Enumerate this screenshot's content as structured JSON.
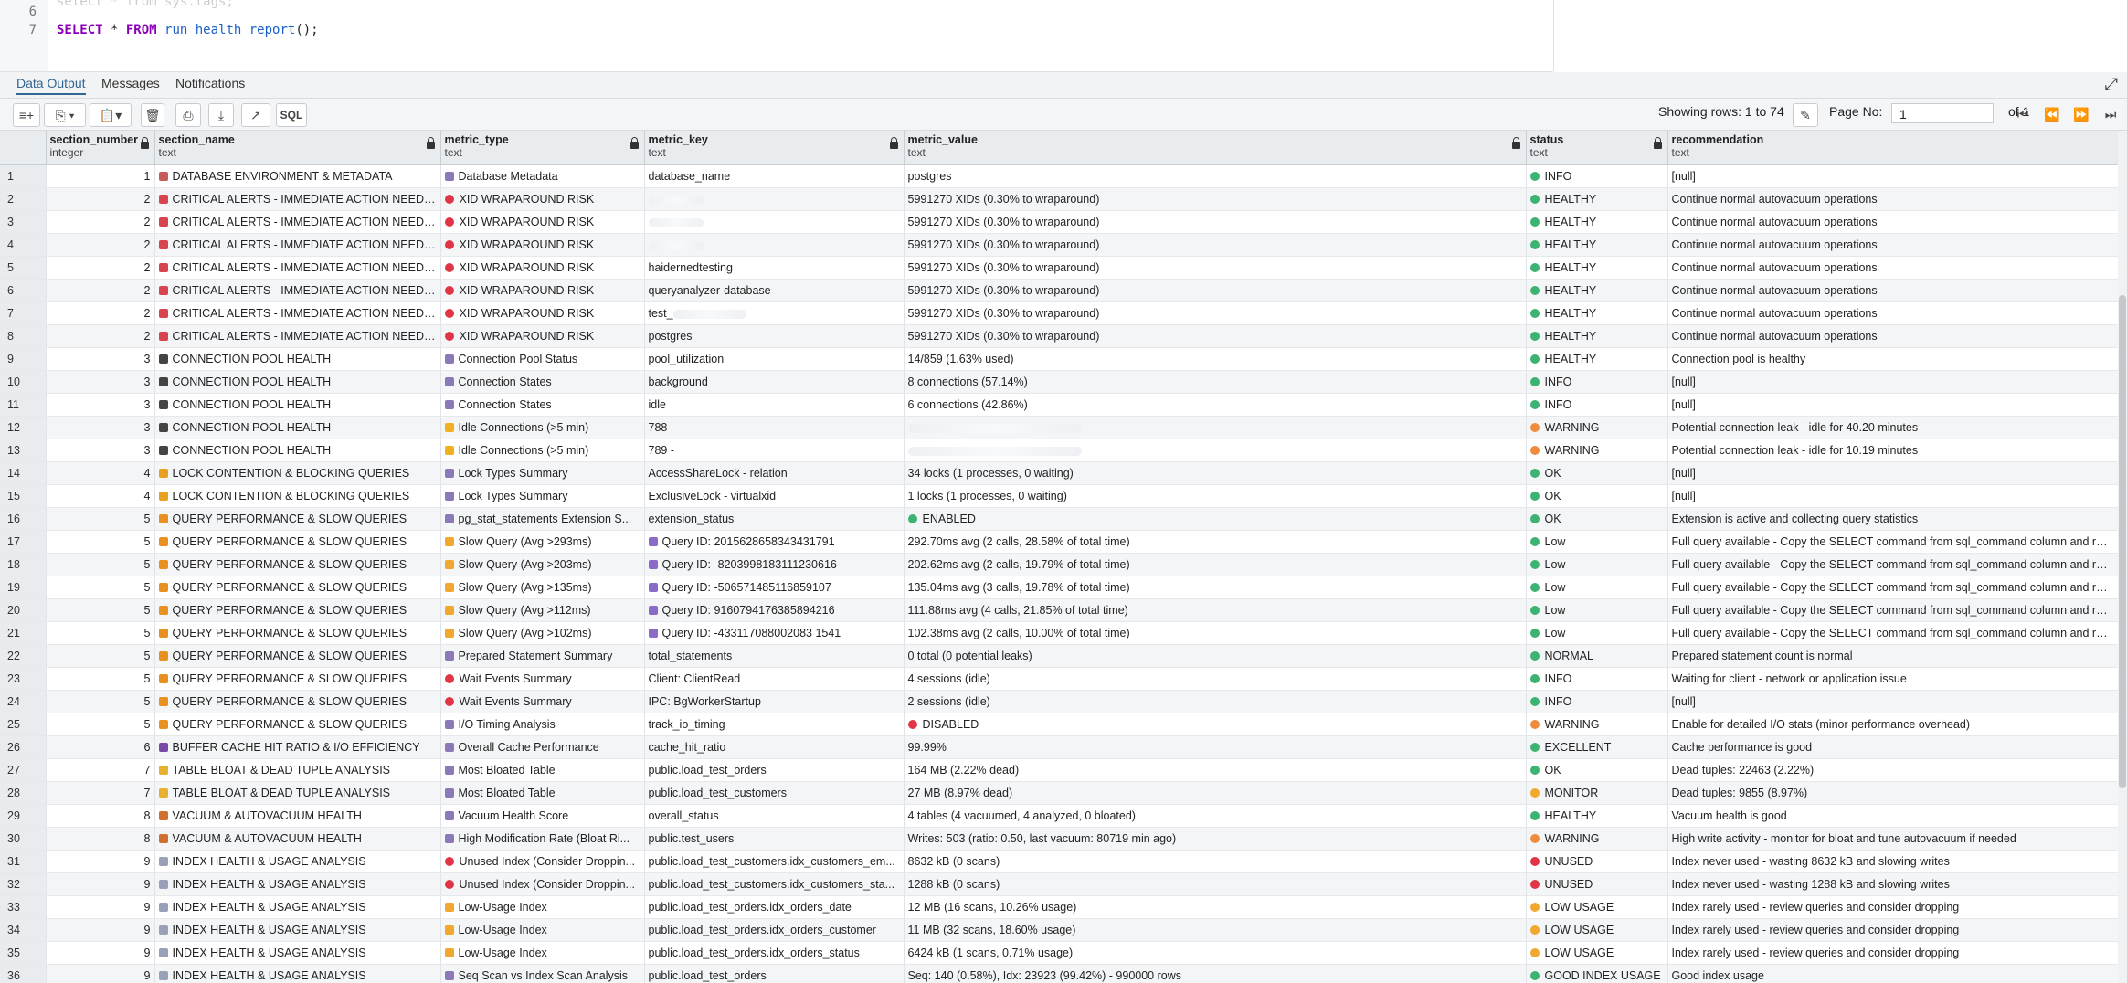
{
  "editor": {
    "line6_number": "6",
    "line7_number": "7",
    "line6_ghost": "select * from sys.tags;",
    "line7_kw1": "SELECT",
    "line7_star": " * ",
    "line7_kw2": "FROM",
    "line7_fn": " run_health_report",
    "line7_end": "();"
  },
  "tabs": [
    "Data Output",
    "Messages",
    "Notifications"
  ],
  "toolbar": {
    "showing_rows": "Showing rows: 1 to 74",
    "page_no_label": "Page No:",
    "page_no_value": "1",
    "of_pages": "of 1",
    "sql_label": "SQL"
  },
  "columns": [
    {
      "name": "section_number",
      "type": "integer"
    },
    {
      "name": "section_name",
      "type": "text"
    },
    {
      "name": "metric_type",
      "type": "text"
    },
    {
      "name": "metric_key",
      "type": "text"
    },
    {
      "name": "metric_value",
      "type": "text"
    },
    {
      "name": "status",
      "type": "text"
    },
    {
      "name": "recommendation",
      "type": "text"
    }
  ],
  "status_colors": {
    "green": "#3cb371",
    "orange": "#f08a3c",
    "red": "#e03546",
    "amber": "#f0a830"
  },
  "rows": [
    [
      "1",
      "1",
      "DATABASE ENVIRONMENT & METADATA",
      "Database Metadata",
      "database_name",
      "postgres",
      "INFO",
      "[null]"
    ],
    [
      "2",
      "2",
      "CRITICAL ALERTS - IMMEDIATE ACTION NEEDED",
      "XID WRAPAROUND RISK",
      "",
      "5991270 XIDs (0.30% to wraparound)",
      "HEALTHY",
      "Continue normal autovacuum operations"
    ],
    [
      "3",
      "2",
      "CRITICAL ALERTS - IMMEDIATE ACTION NEEDED",
      "XID WRAPAROUND RISK",
      "",
      "5991270 XIDs (0.30% to wraparound)",
      "HEALTHY",
      "Continue normal autovacuum operations"
    ],
    [
      "4",
      "2",
      "CRITICAL ALERTS - IMMEDIATE ACTION NEEDED",
      "XID WRAPAROUND RISK",
      "",
      "5991270 XIDs (0.30% to wraparound)",
      "HEALTHY",
      "Continue normal autovacuum operations"
    ],
    [
      "5",
      "2",
      "CRITICAL ALERTS - IMMEDIATE ACTION NEEDED",
      "XID WRAPAROUND RISK",
      "haidernedtesting",
      "5991270 XIDs (0.30% to wraparound)",
      "HEALTHY",
      "Continue normal autovacuum operations"
    ],
    [
      "6",
      "2",
      "CRITICAL ALERTS - IMMEDIATE ACTION NEEDED",
      "XID WRAPAROUND RISK",
      "queryanalyzer-database",
      "5991270 XIDs (0.30% to wraparound)",
      "HEALTHY",
      "Continue normal autovacuum operations"
    ],
    [
      "7",
      "2",
      "CRITICAL ALERTS - IMMEDIATE ACTION NEEDED",
      "XID WRAPAROUND RISK",
      "test_",
      "5991270 XIDs (0.30% to wraparound)",
      "HEALTHY",
      "Continue normal autovacuum operations"
    ],
    [
      "8",
      "2",
      "CRITICAL ALERTS - IMMEDIATE ACTION NEEDED",
      "XID WRAPAROUND RISK",
      "postgres",
      "5991270 XIDs (0.30% to wraparound)",
      "HEALTHY",
      "Continue normal autovacuum operations"
    ],
    [
      "9",
      "3",
      "CONNECTION POOL HEALTH",
      "Connection Pool Status",
      "pool_utilization",
      "14/859 (1.63% used)",
      "HEALTHY",
      "Connection pool is healthy"
    ],
    [
      "10",
      "3",
      "CONNECTION POOL HEALTH",
      "Connection States",
      "background",
      "8 connections (57.14%)",
      "INFO",
      "[null]"
    ],
    [
      "11",
      "3",
      "CONNECTION POOL HEALTH",
      "Connection States",
      "idle",
      "6 connections (42.86%)",
      "INFO",
      "[null]"
    ],
    [
      "12",
      "3",
      "CONNECTION POOL HEALTH",
      "Idle Connections (>5 min)",
      "788 -",
      "",
      "WARNING",
      "Potential connection leak - idle for 40.20 minutes"
    ],
    [
      "13",
      "3",
      "CONNECTION POOL HEALTH",
      "Idle Connections (>5 min)",
      "789 -",
      "",
      "WARNING",
      "Potential connection leak - idle for 10.19 minutes"
    ],
    [
      "14",
      "4",
      "LOCK CONTENTION & BLOCKING QUERIES",
      "Lock Types Summary",
      "AccessShareLock - relation",
      "34 locks (1 processes, 0 waiting)",
      "OK",
      "[null]"
    ],
    [
      "15",
      "4",
      "LOCK CONTENTION & BLOCKING QUERIES",
      "Lock Types Summary",
      "ExclusiveLock - virtualxid",
      "1 locks (1 processes, 0 waiting)",
      "OK",
      "[null]"
    ],
    [
      "16",
      "5",
      "QUERY PERFORMANCE & SLOW QUERIES",
      "pg_stat_statements Extension S...",
      "extension_status",
      "ENABLED",
      "OK",
      "Extension is active and collecting query statistics"
    ],
    [
      "17",
      "5",
      "QUERY PERFORMANCE & SLOW QUERIES",
      "Slow Query (Avg >293ms)",
      "Query ID: 2015628658343431791",
      "292.70ms avg (2 calls, 28.58% of total time)",
      "Low",
      "Full query available - Copy the SELECT command from sql_command column and run it"
    ],
    [
      "18",
      "5",
      "QUERY PERFORMANCE & SLOW QUERIES",
      "Slow Query (Avg >203ms)",
      "Query ID: -8203998183111230616",
      "202.62ms avg (2 calls, 19.79% of total time)",
      "Low",
      "Full query available - Copy the SELECT command from sql_command column and run it"
    ],
    [
      "19",
      "5",
      "QUERY PERFORMANCE & SLOW QUERIES",
      "Slow Query (Avg >135ms)",
      "Query ID: -506571485116859107",
      "135.04ms avg (3 calls, 19.78% of total time)",
      "Low",
      "Full query available - Copy the SELECT command from sql_command column and run it"
    ],
    [
      "20",
      "5",
      "QUERY PERFORMANCE & SLOW QUERIES",
      "Slow Query (Avg >112ms)",
      "Query ID: 9160794176385894216",
      "111.88ms avg (4 calls, 21.85% of total time)",
      "Low",
      "Full query available - Copy the SELECT command from sql_command column and run it"
    ],
    [
      "21",
      "5",
      "QUERY PERFORMANCE & SLOW QUERIES",
      "Slow Query (Avg >102ms)",
      "Query ID: -433117088002083 1541",
      "102.38ms avg (2 calls, 10.00% of total time)",
      "Low",
      "Full query available - Copy the SELECT command from sql_command column and run it"
    ],
    [
      "22",
      "5",
      "QUERY PERFORMANCE & SLOW QUERIES",
      "Prepared Statement Summary",
      "total_statements",
      "0 total (0 potential leaks)",
      "NORMAL",
      "Prepared statement count is normal"
    ],
    [
      "23",
      "5",
      "QUERY PERFORMANCE & SLOW QUERIES",
      "Wait Events Summary",
      "Client: ClientRead",
      "4 sessions (idle)",
      "INFO",
      "Waiting for client - network or application issue"
    ],
    [
      "24",
      "5",
      "QUERY PERFORMANCE & SLOW QUERIES",
      "Wait Events Summary",
      "IPC: BgWorkerStartup",
      "2 sessions (idle)",
      "INFO",
      "[null]"
    ],
    [
      "25",
      "5",
      "QUERY PERFORMANCE & SLOW QUERIES",
      "I/O Timing Analysis",
      "track_io_timing",
      "DISABLED",
      "WARNING",
      "Enable for detailed I/O stats (minor performance overhead)"
    ],
    [
      "26",
      "6",
      "BUFFER CACHE HIT RATIO & I/O EFFICIENCY",
      "Overall Cache Performance",
      "cache_hit_ratio",
      "99.99%",
      "EXCELLENT",
      "Cache performance is good"
    ],
    [
      "27",
      "7",
      "TABLE BLOAT & DEAD TUPLE ANALYSIS",
      "Most Bloated Table",
      "public.load_test_orders",
      "164 MB (2.22% dead)",
      "OK",
      "Dead tuples: 22463 (2.22%)"
    ],
    [
      "28",
      "7",
      "TABLE BLOAT & DEAD TUPLE ANALYSIS",
      "Most Bloated Table",
      "public.load_test_customers",
      "27 MB (8.97% dead)",
      "MONITOR",
      "Dead tuples: 9855 (8.97%)"
    ],
    [
      "29",
      "8",
      "VACUUM & AUTOVACUUM HEALTH",
      "Vacuum Health Score",
      "overall_status",
      "4 tables (4 vacuumed, 4 analyzed, 0 bloated)",
      "HEALTHY",
      "Vacuum health is good"
    ],
    [
      "30",
      "8",
      "VACUUM & AUTOVACUUM HEALTH",
      "High Modification Rate (Bloat Ri...",
      "public.test_users",
      "Writes: 503 (ratio: 0.50, last vacuum: 80719 min ago)",
      "WARNING",
      "High write activity - monitor for bloat and tune autovacuum if needed"
    ],
    [
      "31",
      "9",
      "INDEX HEALTH & USAGE ANALYSIS",
      "Unused Index (Consider Droppin...",
      "public.load_test_customers.idx_customers_em...",
      "8632 kB (0 scans)",
      "UNUSED",
      "Index never used - wasting 8632 kB and slowing writes"
    ],
    [
      "32",
      "9",
      "INDEX HEALTH & USAGE ANALYSIS",
      "Unused Index (Consider Droppin...",
      "public.load_test_customers.idx_customers_sta...",
      "1288 kB (0 scans)",
      "UNUSED",
      "Index never used - wasting 1288 kB and slowing writes"
    ],
    [
      "33",
      "9",
      "INDEX HEALTH & USAGE ANALYSIS",
      "Low-Usage Index",
      "public.load_test_orders.idx_orders_date",
      "12 MB (16 scans, 10.26% usage)",
      "LOW USAGE",
      "Index rarely used - review queries and consider dropping"
    ],
    [
      "34",
      "9",
      "INDEX HEALTH & USAGE ANALYSIS",
      "Low-Usage Index",
      "public.load_test_orders.idx_orders_customer",
      "11 MB (32 scans, 18.60% usage)",
      "LOW USAGE",
      "Index rarely used - review queries and consider dropping"
    ],
    [
      "35",
      "9",
      "INDEX HEALTH & USAGE ANALYSIS",
      "Low-Usage Index",
      "public.load_test_orders.idx_orders_status",
      "6424 kB (1 scans, 0.71% usage)",
      "LOW USAGE",
      "Index rarely used - review queries and consider dropping"
    ],
    [
      "36",
      "9",
      "INDEX HEALTH & USAGE ANALYSIS",
      "Seq Scan vs Index Scan Analysis",
      "public.load_test_orders",
      "Seq: 140 (0.58%), Idx: 23923 (99.42%) - 990000 rows",
      "GOOD INDEX USAGE",
      "Good index usage"
    ]
  ]
}
